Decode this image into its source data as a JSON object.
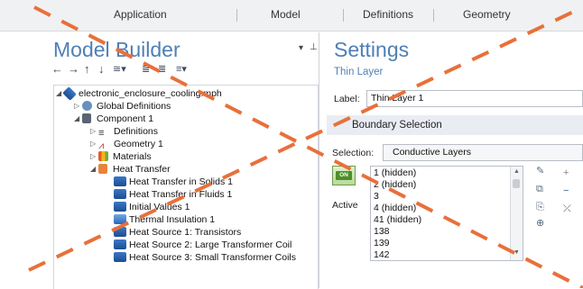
{
  "ribbon": {
    "tabs": [
      "Application",
      "Model",
      "Definitions",
      "Geometry"
    ]
  },
  "model_builder": {
    "title": "Model Builder",
    "menu_icons": [
      "dropdown-arrow-icon",
      "pin-icon"
    ],
    "toolbar_icons": [
      "back-arrow-icon",
      "forward-arrow-icon",
      "move-up-icon",
      "move-down-icon",
      "show-icon",
      "expand-sections-icon",
      "collapse-sections-icon",
      "list-options-icon"
    ],
    "tree": [
      {
        "label": "electronic_enclosure_cooling.mph",
        "icon": "root-model-icon"
      },
      {
        "label": "Global Definitions",
        "icon": "globe-icon"
      },
      {
        "label": "Component 1",
        "icon": "component-icon"
      },
      {
        "label": "Definitions",
        "icon": "definitions-icon"
      },
      {
        "label": "Geometry 1",
        "icon": "geometry-icon"
      },
      {
        "label": "Materials",
        "icon": "materials-icon"
      },
      {
        "label": "Heat Transfer",
        "icon": "heat-transfer-icon"
      },
      {
        "label": "Heat Transfer in Solids 1",
        "icon": "physics-feature-icon"
      },
      {
        "label": "Heat Transfer in Fluids 1",
        "icon": "physics-feature-icon"
      },
      {
        "label": "Initial Values 1",
        "icon": "physics-feature-icon"
      },
      {
        "label": "Thermal Insulation 1",
        "icon": "insulation-icon"
      },
      {
        "label": "Heat Source 1: Transistors",
        "icon": "physics-feature-icon"
      },
      {
        "label": "Heat Source 2: Large Transformer Coil",
        "icon": "physics-feature-icon"
      },
      {
        "label": "Heat Source 3: Small Transformer Coils",
        "icon": "physics-feature-icon"
      }
    ]
  },
  "settings": {
    "title": "Settings",
    "subtitle": "Thin Layer",
    "label_caption": "Label:",
    "label_value": "Thin Layer 1",
    "section": "Boundary Selection",
    "selection_caption": "Selection:",
    "selection_value": "Conductive Layers",
    "active_badge": "ON",
    "active_label": "Active",
    "boundaries": [
      "1 (hidden)",
      "2 (hidden)",
      "3",
      "4 (hidden)",
      "41 (hidden)",
      "138",
      "139",
      "142"
    ]
  },
  "colors": {
    "title_blue": "#4f7fb6",
    "overlay_orange": "#e8703a"
  }
}
